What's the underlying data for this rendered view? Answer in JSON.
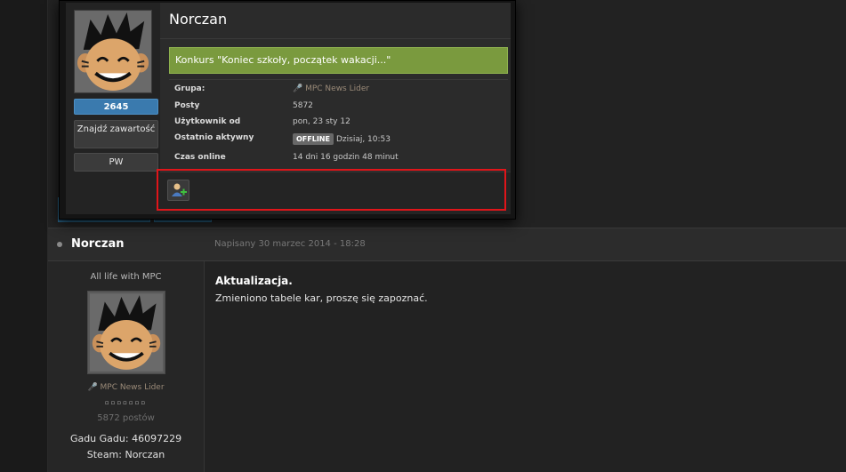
{
  "hovercard": {
    "name": "Norczan",
    "status_message": "Konkurs \"Koniec szkoły, początek wakacji...\"",
    "reputation_count": "2645",
    "find_content_label": "Znajdź zawartość",
    "pm_label": "PW",
    "fields": [
      {
        "label": "Grupa:",
        "value": "MPC News Lider"
      },
      {
        "label": "Posty",
        "value": "5872"
      },
      {
        "label": "Użytkownik od",
        "value": "pon, 23 sty 12"
      },
      {
        "label": "Ostatnio aktywny",
        "badge": "OFFLINE",
        "value": "Dzisiaj, 10:53"
      },
      {
        "label": "Czas online",
        "value": "14 dni 16 godzin 48 minut"
      }
    ],
    "add_friend_icon": "add-friend-icon"
  },
  "post": {
    "author": "Norczan",
    "date": "Napisany 30 marzec 2014 - 18:28",
    "title": "Aktualizacja.",
    "text": "Zmieniono tabele kar, proszę się zapoznać."
  },
  "author_panel": {
    "title": "All life with MPC",
    "group": "MPC News Lider",
    "pips": "▫▫▫▫▫▫▫",
    "posts": "5872 postów",
    "gadu_gadu": "Gadu Gadu: 46097229",
    "steam": "Steam: Norczan"
  },
  "colors": {
    "status_bg": "#7a9a3e",
    "reputation_bg": "#3a7aae",
    "highlight": "#e0151a",
    "group_color": "#9a8a78"
  }
}
